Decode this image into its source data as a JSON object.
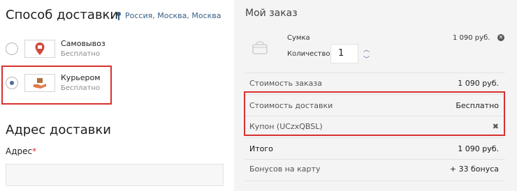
{
  "shipping": {
    "title": "Способ доставки",
    "location": "Россия, Москва, Москва",
    "options": [
      {
        "name": "Самовывоз",
        "price": "Бесплатно",
        "selected": false
      },
      {
        "name": "Курьером",
        "price": "Бесплатно",
        "selected": true
      }
    ]
  },
  "address": {
    "title": "Адрес доставки",
    "label": "Адрес",
    "required_mark": "*",
    "value": ""
  },
  "order": {
    "title": "Мой заказ",
    "product": {
      "name": "Сумка",
      "qty_label": "Количество:",
      "qty": "1",
      "price": "1 090 руб."
    },
    "rows": {
      "subtotal": {
        "label": "Стоимость заказа",
        "value": "1 090 руб."
      },
      "delivery": {
        "label": "Стоимость доставки",
        "value": "Бесплатно"
      },
      "coupon": {
        "label": "Купон (UCzxQBSL)",
        "value": "✖"
      },
      "total": {
        "label": "Итого",
        "value": "1 090 руб."
      },
      "bonus": {
        "label": "Бонусов на карту",
        "value": "+ 33 бонуса"
      }
    }
  },
  "colors": {
    "highlight": "#d83030",
    "accent": "#4a6f9c",
    "right_bg": "#f4f4f4"
  },
  "icons": [
    "map-pin-icon",
    "pickup-pin-icon",
    "courier-box-icon",
    "bag-icon",
    "remove-icon",
    "chevron-up-icon",
    "chevron-down-icon"
  ]
}
